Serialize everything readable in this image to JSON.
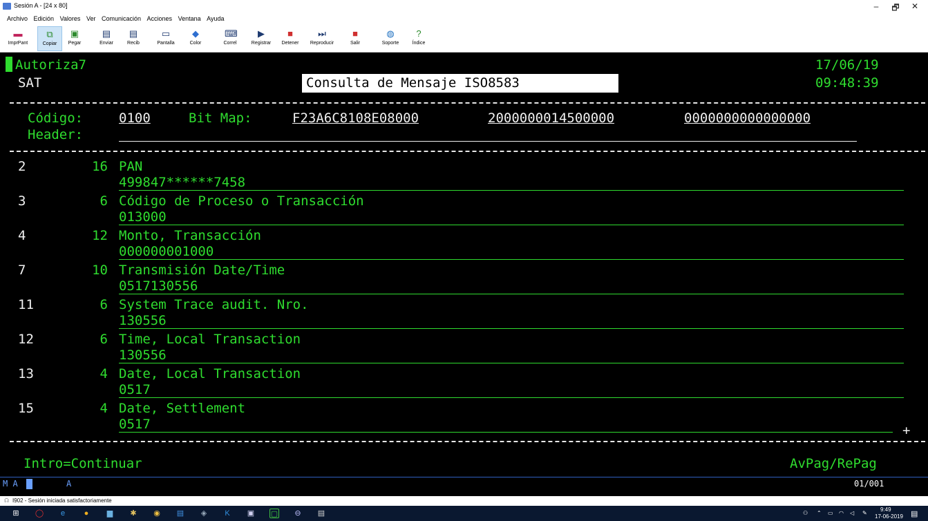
{
  "window": {
    "title": "Sesión A - [24 x 80]",
    "min": "–",
    "max": "🗗",
    "close": "✕"
  },
  "menu": [
    "Archivo",
    "Edición",
    "Valores",
    "Ver",
    "Comunicación",
    "Acciones",
    "Ventana",
    "Ayuda"
  ],
  "toolbar": [
    {
      "label": "ImprPant",
      "icon": "print-screen-icon",
      "color": "#c0245c",
      "glyph": "▬"
    },
    {
      "label": "Copiar",
      "icon": "copy-icon",
      "color": "#2c8a2c",
      "glyph": "⧉"
    },
    {
      "label": "Pegar",
      "icon": "paste-icon",
      "color": "#2c8a2c",
      "glyph": "▣"
    },
    {
      "label": "Enviar",
      "icon": "send-icon",
      "color": "#1e3a70",
      "glyph": "▤"
    },
    {
      "label": "Recib",
      "icon": "receive-icon",
      "color": "#1e3a70",
      "glyph": "▤"
    },
    {
      "label": "Pantalla",
      "icon": "screen-icon",
      "color": "#1e3a70",
      "glyph": "▭"
    },
    {
      "label": "Color",
      "icon": "color-icon",
      "color": "#2f6fd0",
      "glyph": "◆"
    },
    {
      "label": "Correl",
      "icon": "keyboard-icon",
      "color": "#1e3a70",
      "glyph": "⌨"
    },
    {
      "label": "Registrar",
      "icon": "record-icon",
      "color": "#1e3a70",
      "glyph": "▶"
    },
    {
      "label": "Detener",
      "icon": "stop-icon",
      "color": "#d03030",
      "glyph": "■"
    },
    {
      "label": "Reproducir",
      "icon": "play-icon",
      "color": "#1e3a70",
      "glyph": "⏭"
    },
    {
      "label": "Salir",
      "icon": "exit-icon",
      "color": "#d03030",
      "glyph": "■"
    },
    {
      "label": "Soporte",
      "icon": "support-icon",
      "color": "#1e70c0",
      "glyph": "◍"
    },
    {
      "label": "Índice",
      "icon": "help-icon",
      "color": "#2c8a2c",
      "glyph": "?"
    }
  ],
  "terminal": {
    "app_id": "Autoriza7",
    "date": "17/06/19",
    "system": "SAT",
    "screen_title": "Consulta de Mensaje ISO8583",
    "time": "09:48:39",
    "codigo_label": "Código:",
    "codigo_value": "0100",
    "bitmap_label": "Bit Map:",
    "bitmap_values": [
      "F23A6C8108E08000",
      "2000000014500000",
      "0000000000000000"
    ],
    "header_label": "Header:",
    "header_value": "",
    "fields": [
      {
        "bit": "2",
        "len": "16",
        "name": "PAN",
        "value": "499847******7458"
      },
      {
        "bit": "3",
        "len": "6",
        "name": "Código de Proceso o Transacción",
        "value": "013000"
      },
      {
        "bit": "4",
        "len": "12",
        "name": "Monto, Transacción",
        "value": "000000001000"
      },
      {
        "bit": "7",
        "len": "10",
        "name": "Transmisión Date/Time",
        "value": "0517130556"
      },
      {
        "bit": "11",
        "len": "6",
        "name": "System Trace audit. Nro.",
        "value": "130556"
      },
      {
        "bit": "12",
        "len": "6",
        "name": "Time, Local Transaction",
        "value": "130556"
      },
      {
        "bit": "13",
        "len": "4",
        "name": "Date, Local Transaction",
        "value": "0517"
      },
      {
        "bit": "15",
        "len": "4",
        "name": "Date, Settlement",
        "value": "0517"
      }
    ],
    "more_indicator": "+",
    "footer_left": "Intro=Continuar",
    "footer_right": "AvPag/RePag"
  },
  "oia": {
    "mode": "M A",
    "field_a": "A",
    "position": "01/001"
  },
  "status": "I902 - Sesión iniciada satisfactoriamente",
  "tray": {
    "time": "9:49",
    "date": "17-06-2019"
  }
}
